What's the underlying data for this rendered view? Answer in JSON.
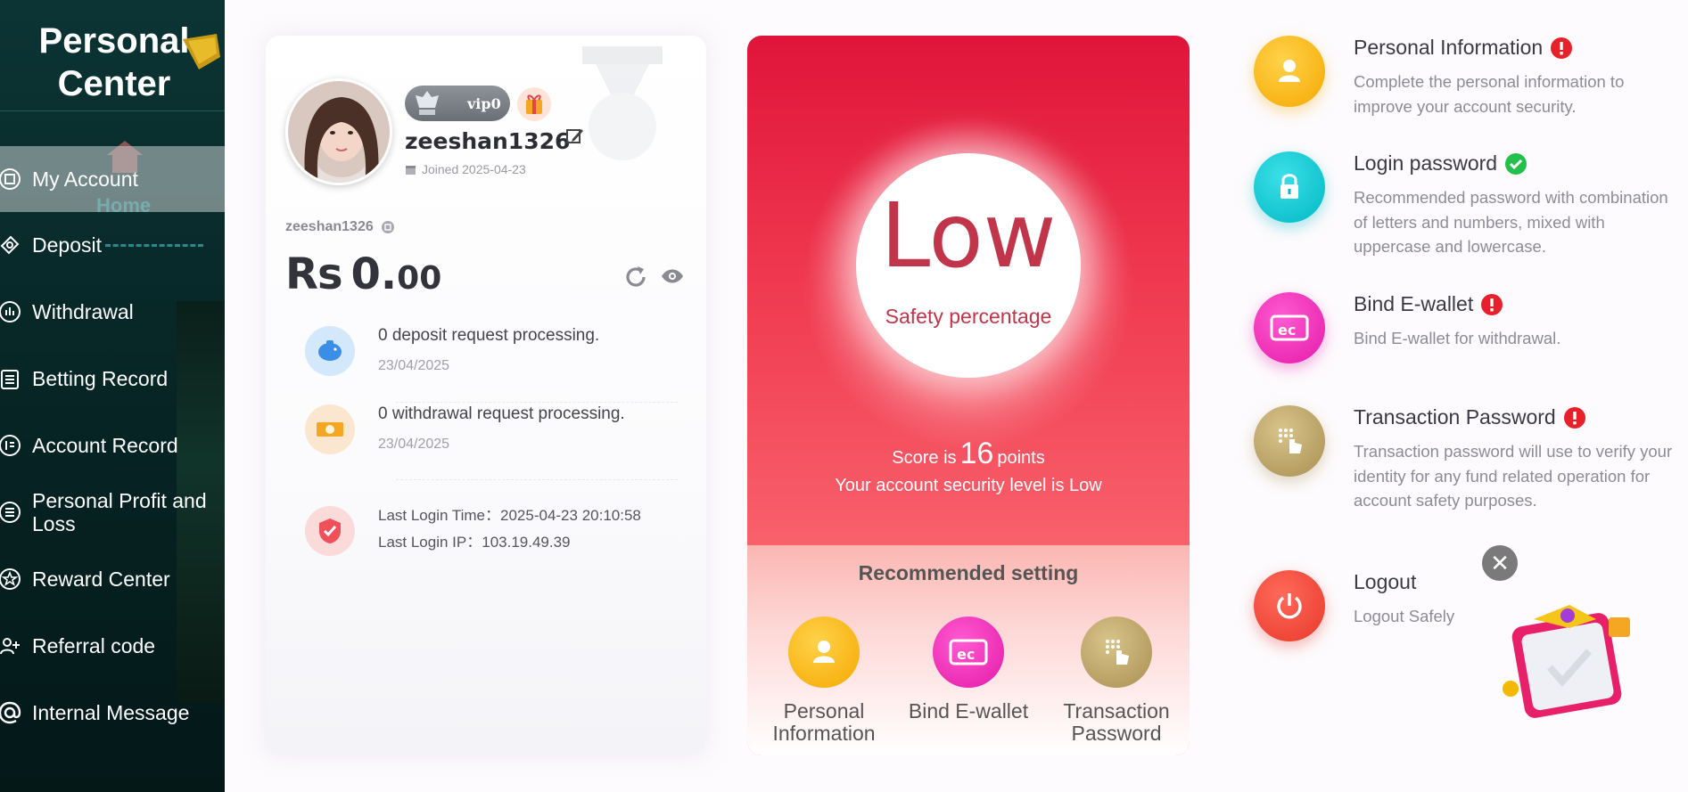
{
  "sidebar": {
    "title": "Personal Center",
    "home_ghost": "Home",
    "items": [
      {
        "label": "My Account",
        "icon": "account-icon"
      },
      {
        "label": "Deposit",
        "icon": "deposit-icon"
      },
      {
        "label": "Withdrawal",
        "icon": "withdrawal-icon"
      },
      {
        "label": "Betting Record",
        "icon": "clipboard-icon"
      },
      {
        "label": "Account Record",
        "icon": "record-icon"
      },
      {
        "label": "Personal Profit and Loss",
        "icon": "list-icon"
      },
      {
        "label": "Reward Center",
        "icon": "star-icon"
      },
      {
        "label": "Referral code",
        "icon": "add-user-icon"
      },
      {
        "label": "Internal Message",
        "icon": "at-icon"
      }
    ]
  },
  "profile": {
    "vip": "vip0",
    "username": "zeeshan1326",
    "joined": "Joined 2025-04-23",
    "username_small": "zeeshan1326",
    "balance_currency": "Rs",
    "balance_int": "0.",
    "balance_dec": "00",
    "deposit_text": "0 deposit request processing.",
    "deposit_date": "23/04/2025",
    "withdraw_text": "0 withdrawal request processing.",
    "withdraw_date": "23/04/2025",
    "last_login_time": "Last Login Time：2025-04-23 20:10:58",
    "last_login_ip": "Last Login IP：103.19.49.39"
  },
  "security": {
    "level_big": "Low",
    "safety_label": "Safety percentage",
    "score_prefix": "Score is",
    "score": "16",
    "score_suffix": "points",
    "level_text": "Your account security level is Low",
    "recommended_title": "Recommended setting",
    "recommended": [
      {
        "label": "Personal Information"
      },
      {
        "label": "Bind E-wallet"
      },
      {
        "label": "Transaction Password"
      }
    ]
  },
  "settings": [
    {
      "title": "Personal Information",
      "desc": "Complete the personal information to improve your account security.",
      "status": "warning"
    },
    {
      "title": "Login password",
      "desc": "Recommended password with combination of letters and numbers, mixed with uppercase and lowercase.",
      "status": "ok"
    },
    {
      "title": "Bind E-wallet",
      "desc": "Bind E-wallet for withdrawal.",
      "status": "warning"
    },
    {
      "title": "Transaction Password",
      "desc": "Transaction password will use to verify your identity for any fund related operation for account safety purposes.",
      "status": "warning"
    },
    {
      "title": "Logout",
      "desc": "Logout Safely",
      "status": ""
    }
  ],
  "colors": {
    "sidebar_bg": "#0c3434",
    "security_red": "#e0143a",
    "low_text": "#c0354a",
    "warning": "#e8202a",
    "ok": "#22c04a"
  }
}
